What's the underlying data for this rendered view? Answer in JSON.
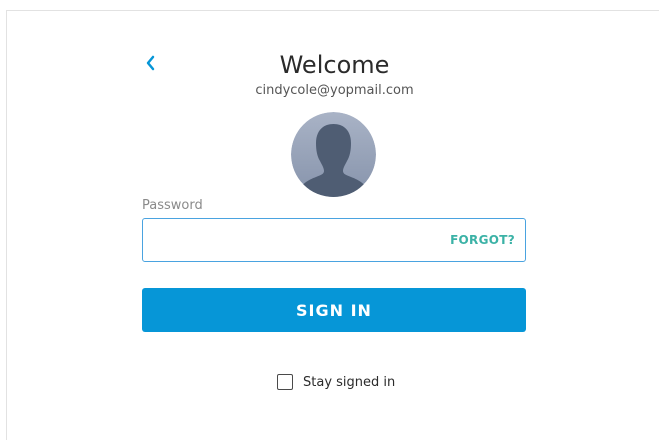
{
  "header": {
    "title": "Welcome",
    "email": "cindycole@yopmail.com"
  },
  "password": {
    "label": "Password",
    "value": "",
    "forgot_label": "FORGOT?"
  },
  "signin": {
    "label": "SIGN IN"
  },
  "stay_signed_in": {
    "label": "Stay signed in",
    "checked": false
  },
  "icons": {
    "back": "chevron-left-icon",
    "avatar": "default-user-avatar"
  },
  "colors": {
    "primary": "#0696d7",
    "accent_teal": "#3bb2a6",
    "field_border": "#4aa3e0",
    "back_chevron": "#0696d7",
    "avatar_bg": "#9aa7bd",
    "avatar_silhouette": "#4f5d73"
  }
}
